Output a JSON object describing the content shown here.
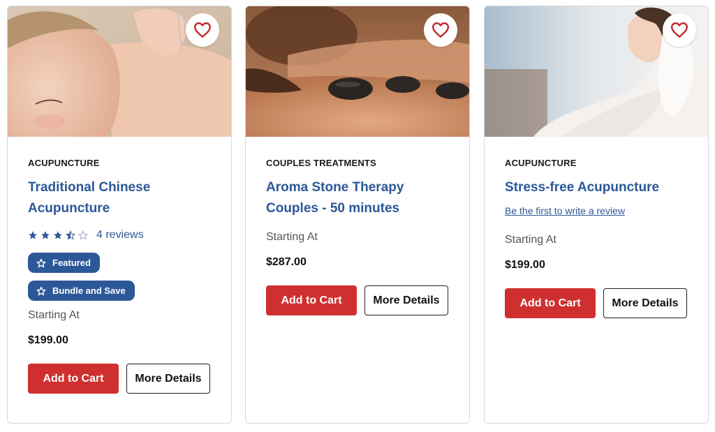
{
  "colors": {
    "title_blue": "#2c5897",
    "badge_blue": "#2c5897",
    "cart_red": "#cf2f2f",
    "heart_red": "#c0282d",
    "star_blue": "#2c5897"
  },
  "icons": {
    "favorite": "heart-icon",
    "rating": "star-icon",
    "badge": "star-outline-icon"
  },
  "products": [
    {
      "category": "ACUPUNCTURE",
      "title": "Traditional Chinese Acupuncture",
      "rating": 3.5,
      "rating_max": 5,
      "reviews_label": "4 reviews",
      "badges": [
        "Featured",
        "Bundle and Save"
      ],
      "starting_label": "Starting At",
      "price": "$199.00",
      "add_to_cart": "Add to Cart",
      "more_details": "More Details"
    },
    {
      "category": "COUPLES TREATMENTS",
      "title": "Aroma Stone Therapy Couples - 50 minutes",
      "starting_label": "Starting At",
      "price": "$287.00",
      "add_to_cart": "Add to Cart",
      "more_details": "More Details"
    },
    {
      "category": "ACUPUNCTURE",
      "title": "Stress-free Acupuncture",
      "review_link": "Be the first to write a review",
      "starting_label": "Starting At",
      "price": "$199.00",
      "add_to_cart": "Add to Cart",
      "more_details": "More Details"
    }
  ]
}
